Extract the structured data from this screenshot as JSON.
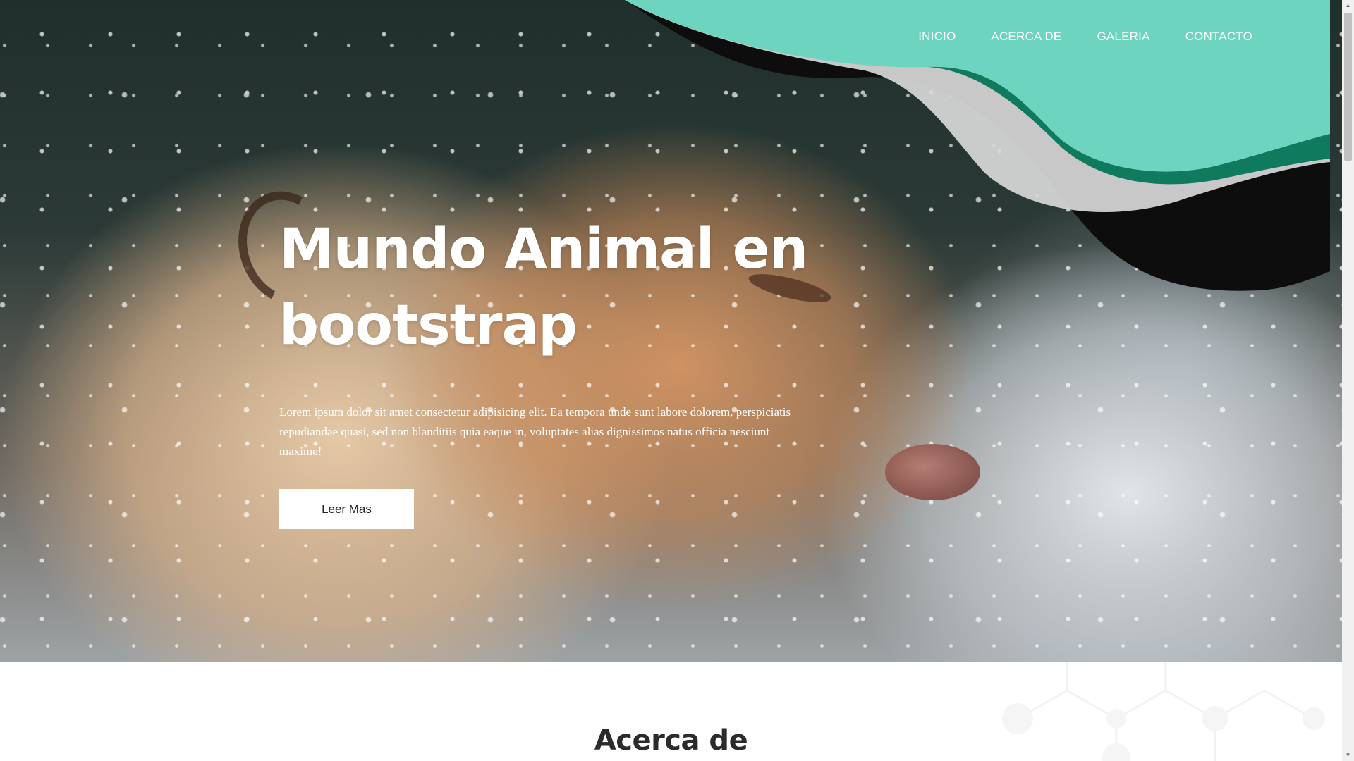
{
  "nav": {
    "items": [
      {
        "label": "INICIO"
      },
      {
        "label": "ACERCA DE"
      },
      {
        "label": "GALERIA"
      },
      {
        "label": "CONTACTO"
      }
    ]
  },
  "hero": {
    "title": "Mundo Animal en bootstrap",
    "text": "Lorem ipsum dolor sit amet consectetur adipisicing elit. Ea tempora unde sunt labore dolorem, perspiciatis repudiandae quasi, sed non blanditiis quia eaque in, voluptates alias dignissimos natus officia nesciunt maxime!",
    "button_label": "Leer Mas"
  },
  "about": {
    "title": "Acerca de"
  },
  "colors": {
    "accent": "#6dd4c0",
    "accent_dark": "#0f7a5e",
    "wave_dark": "#0d0d0d",
    "wave_light": "#d8d8d8"
  },
  "icons": {
    "scroll_up": "triangle-up-icon",
    "scroll_down": "triangle-down-icon"
  }
}
